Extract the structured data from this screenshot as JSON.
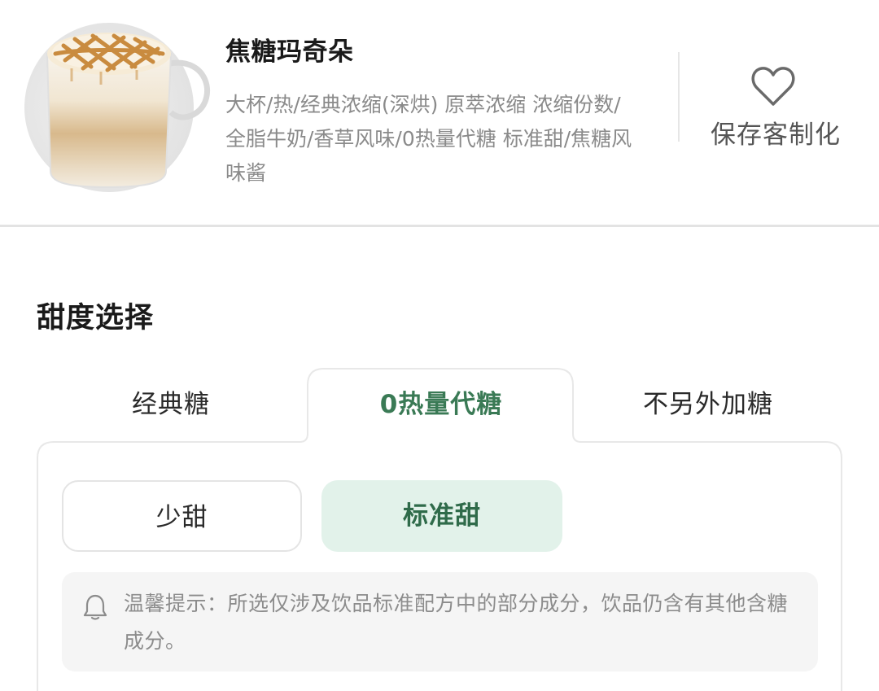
{
  "product": {
    "name": "焦糖玛奇朵",
    "spec": "大杯/热/经典浓缩(深烘) 原萃浓缩 浓缩份数/全脂牛奶/香草风味/0热量代糖 标准甜/焦糖风味酱",
    "image_icon": "caramel-macchiato-cup",
    "save_label": "保存客制化",
    "save_icon": "heart-outline-icon"
  },
  "sweetness": {
    "title": "甜度选择",
    "tabs": [
      {
        "label": "经典糖",
        "selected": false
      },
      {
        "label": "0热量代糖",
        "selected": true
      },
      {
        "label": "不另外加糖",
        "selected": false
      }
    ],
    "levels": [
      {
        "label": "少甜",
        "selected": false
      },
      {
        "label": "标准甜",
        "selected": true
      }
    ],
    "tip": {
      "icon": "bell-icon",
      "text": "温馨提示：所选仅涉及饮品标准配方中的部分成分，饮品仍含有其他含糖成分。"
    }
  },
  "colors": {
    "accent_green": "#3a7a55",
    "selected_bg": "#e2f2ea",
    "muted_text": "#8a8a8a",
    "tip_bg": "#f5f5f5",
    "caramel": "#c98b3f"
  }
}
